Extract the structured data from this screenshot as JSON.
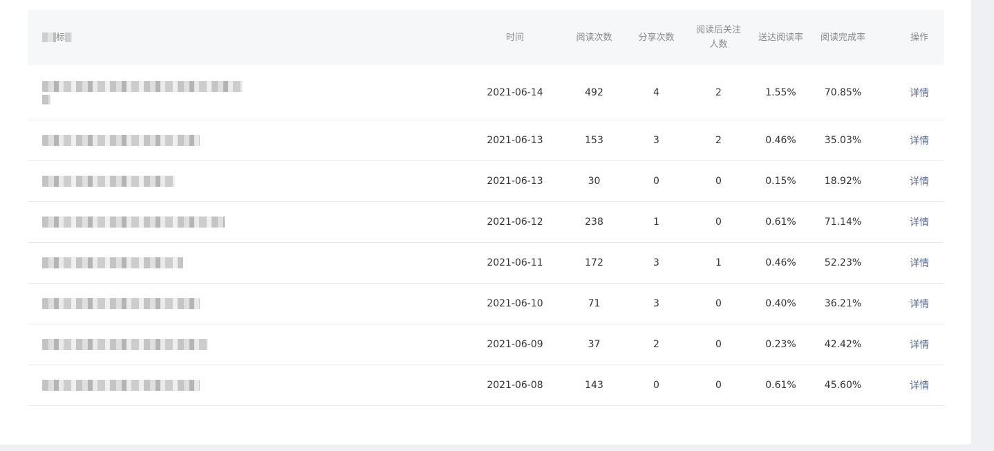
{
  "table": {
    "headers": {
      "title": "标",
      "time": "时间",
      "reads": "阅读次数",
      "shares": "分享次数",
      "follow": "阅读后关注人数",
      "delivery_rate": "送达阅读率",
      "completion_rate": "阅读完成率",
      "action": "操作"
    },
    "rows": [
      {
        "time": "2021-06-14",
        "reads": "492",
        "shares": "4",
        "follow": "2",
        "delivery_rate": "1.55%",
        "completion_rate": "70.85%",
        "action": "详情"
      },
      {
        "time": "2021-06-13",
        "reads": "153",
        "shares": "3",
        "follow": "2",
        "delivery_rate": "0.46%",
        "completion_rate": "35.03%",
        "action": "详情"
      },
      {
        "time": "2021-06-13",
        "reads": "30",
        "shares": "0",
        "follow": "0",
        "delivery_rate": "0.15%",
        "completion_rate": "18.92%",
        "action": "详情"
      },
      {
        "time": "2021-06-12",
        "reads": "238",
        "shares": "1",
        "follow": "0",
        "delivery_rate": "0.61%",
        "completion_rate": "71.14%",
        "action": "详情"
      },
      {
        "time": "2021-06-11",
        "reads": "172",
        "shares": "3",
        "follow": "1",
        "delivery_rate": "0.46%",
        "completion_rate": "52.23%",
        "action": "详情"
      },
      {
        "time": "2021-06-10",
        "reads": "71",
        "shares": "3",
        "follow": "0",
        "delivery_rate": "0.40%",
        "completion_rate": "36.21%",
        "action": "详情"
      },
      {
        "time": "2021-06-09",
        "reads": "37",
        "shares": "2",
        "follow": "0",
        "delivery_rate": "0.23%",
        "completion_rate": "42.42%",
        "action": "详情"
      },
      {
        "time": "2021-06-08",
        "reads": "143",
        "shares": "0",
        "follow": "0",
        "delivery_rate": "0.61%",
        "completion_rate": "45.60%",
        "action": "详情"
      }
    ]
  }
}
